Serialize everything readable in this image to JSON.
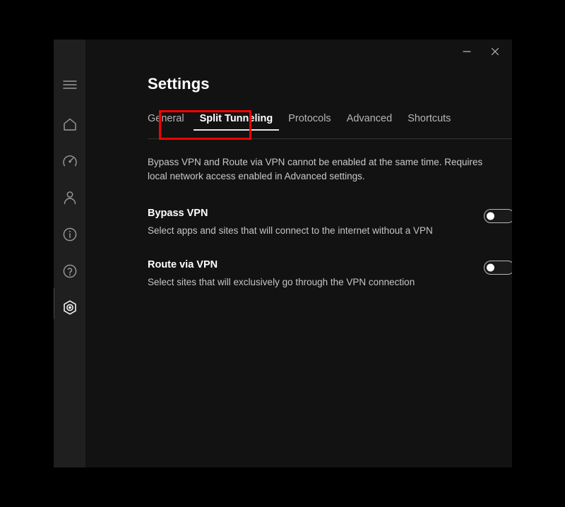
{
  "window": {
    "title_controls": {
      "minimize_label": "—",
      "minimize_icon": "minimize-icon",
      "close_label": "✕",
      "close_icon": "close-icon"
    },
    "background_color": "#121212",
    "sidebar_color": "#1f1f1f"
  },
  "sidebar": {
    "items": [
      {
        "name": "menu",
        "icon": "hamburger-menu-icon",
        "active": false
      },
      {
        "name": "home",
        "icon": "home-icon",
        "active": false
      },
      {
        "name": "speed-test",
        "icon": "speedometer-icon",
        "active": false
      },
      {
        "name": "account",
        "icon": "person-icon",
        "active": false
      },
      {
        "name": "info",
        "icon": "info-circle-icon",
        "active": false
      },
      {
        "name": "help",
        "icon": "help-circle-icon",
        "active": false
      },
      {
        "name": "settings",
        "icon": "gear-hex-icon",
        "active": true
      }
    ]
  },
  "header": {
    "title": "Settings"
  },
  "tabs": [
    {
      "label": "General",
      "active": false
    },
    {
      "label": "Split Tunneling",
      "active": true
    },
    {
      "label": "Protocols",
      "active": false
    },
    {
      "label": "Advanced",
      "active": false
    },
    {
      "label": "Shortcuts",
      "active": false
    }
  ],
  "main": {
    "notice": "Bypass VPN and Route via VPN cannot be enabled at the same time. Requires local network access enabled in Advanced settings.",
    "settings": [
      {
        "title": "Bypass VPN",
        "description": "Select apps and sites that will connect to the internet without a VPN",
        "toggle_state": "off"
      },
      {
        "title": "Route via VPN",
        "description": "Select sites that will exclusively go through the VPN connection",
        "toggle_state": "off"
      }
    ]
  },
  "annotation": {
    "color": "#ff0000",
    "target": "Split Tunneling"
  }
}
